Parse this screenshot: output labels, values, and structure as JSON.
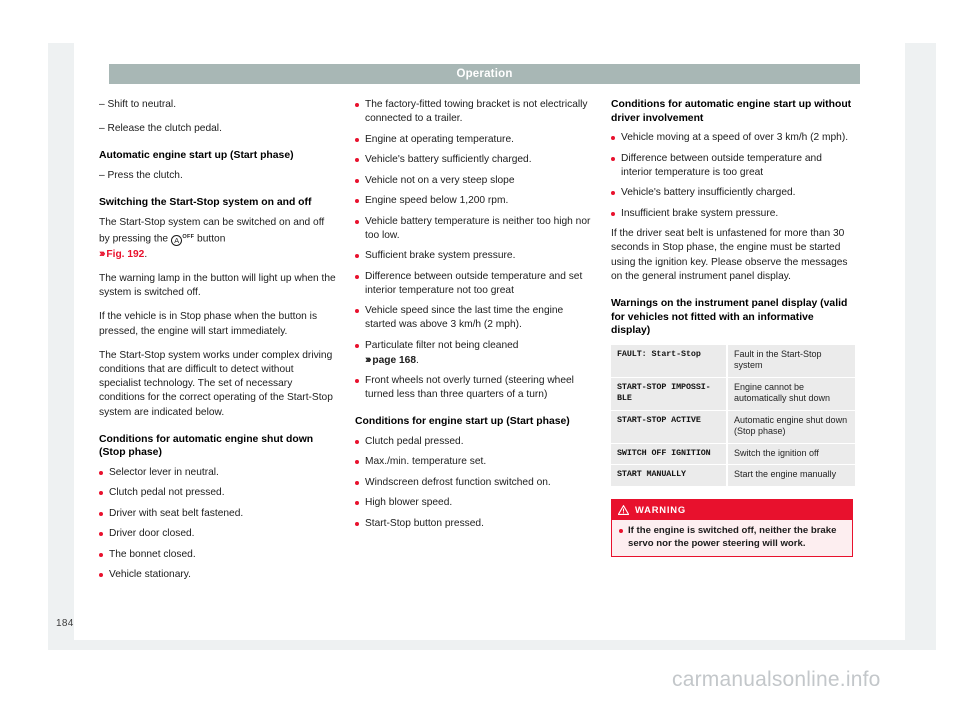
{
  "header": {
    "title": "Operation"
  },
  "page_number": "184",
  "watermark": "carmanualsonline.info",
  "column1": {
    "dash_items": [
      "– Shift to neutral.",
      "– Release the clutch pedal."
    ],
    "heading_start_phase": "Automatic engine start up (Start phase)",
    "dash_item_press_clutch": "– Press the clutch.",
    "heading_switching": "Switching the Start-Stop system on and off",
    "para_switch_1_a": "The Start-Stop system can be switched on and off by pressing the ",
    "para_switch_1_b": " button",
    "icon_button_letter": "A",
    "icon_button_off": "OFF",
    "fig_arrows": "›››",
    "fig_ref": "Fig. 192",
    "fig_ref_period": ".",
    "para_warning_lamp": "The warning lamp in the button will light up when the system is switched off.",
    "para_stop_phase": "If the vehicle is in Stop phase when the button is pressed, the engine will start immediately.",
    "para_complex": "The Start-Stop system works under complex driving conditions that are difficult to detect without specialist technology. The set of necessary conditions for the correct operating of the Start-Stop system are indicated below.",
    "heading_shutdown": "Conditions for automatic engine shut down (Stop phase)",
    "shutdown_bullets": [
      "Selector lever in neutral.",
      "Clutch pedal not pressed.",
      "Driver with seat belt fastened.",
      "Driver door closed.",
      "The bonnet closed.",
      "Vehicle stationary."
    ]
  },
  "column2": {
    "shutdown_bullets_cont": [
      "The factory-fitted towing bracket is not electrically connected to a trailer.",
      "Engine at operating temperature.",
      "Vehicle's battery sufficiently charged.",
      "Vehicle not on a very steep slope",
      "Engine speed below 1,200 rpm.",
      "Vehicle battery temperature is neither too high nor too low.",
      "Sufficient brake system pressure.",
      "Difference between outside temperature and set interior temperature not too great",
      "Vehicle speed since the last time the engine started was above 3 km/h (2 mph)."
    ],
    "particulate_bullet_text": "Particulate filter not being cleaned",
    "particulate_arrows": "›››",
    "particulate_page_ref": "page 168",
    "particulate_period": ".",
    "front_wheels_bullet": "Front wheels not overly turned (steering wheel turned less than three quarters of a turn)",
    "heading_startup": "Conditions for engine start up (Start phase)",
    "startup_bullets": [
      "Clutch pedal pressed.",
      "Max./min. temperature set.",
      "Windscreen defrost function switched on.",
      "High blower speed.",
      "Start-Stop button pressed."
    ]
  },
  "column3": {
    "heading_no_driver": "Conditions for automatic engine start up without driver involvement",
    "no_driver_bullets": [
      "Vehicle moving at a speed of over 3 km/h (2 mph).",
      "Difference between outside temperature and interior temperature is too great",
      "Vehicle's battery insufficiently charged.",
      "Insufficient brake system pressure."
    ],
    "para_seatbelt": "If the driver seat belt is unfastened for more than 30 seconds in Stop phase, the engine must be started using the ignition key. Please observe the messages on the general instrument panel display.",
    "heading_warnings": "Warnings on the instrument panel display (valid for vehicles not fitted with an informative display)",
    "table": {
      "rows": [
        {
          "code": "FAULT: Start-Stop",
          "desc": "Fault in the Start-Stop system"
        },
        {
          "code": "START-STOP IMPOSSI-BLE",
          "desc": "Engine cannot be automatically shut down"
        },
        {
          "code": "START-STOP ACTIVE",
          "desc": "Automatic engine shut down (Stop phase)"
        },
        {
          "code": "SWITCH OFF IGNITION",
          "desc": "Switch the ignition off"
        },
        {
          "code": "START MANUALLY",
          "desc": "Start the engine manually"
        }
      ]
    },
    "warning_box": {
      "title": "WARNING",
      "icon": "warning-triangle-icon",
      "items": [
        "If the engine is switched off, neither the brake servo nor the power steering will work."
      ]
    }
  },
  "colors": {
    "accent_red": "#e8112d",
    "header_band": "#a8b7b5",
    "mat": "#eef1f2",
    "table_cell": "#ebebeb",
    "warning_bg": "#fdeef0"
  }
}
